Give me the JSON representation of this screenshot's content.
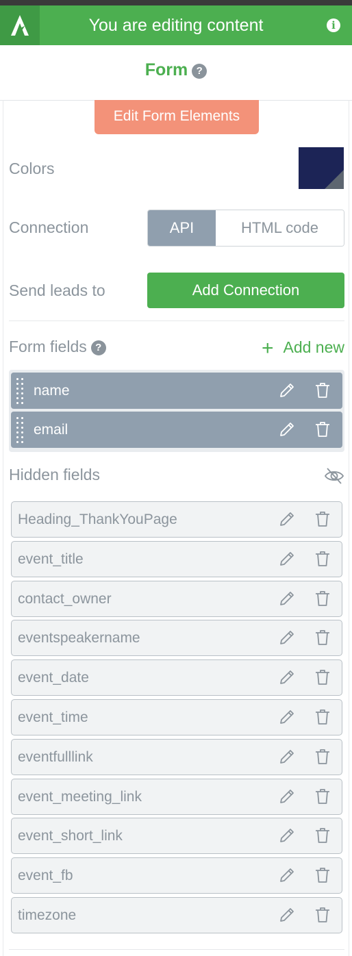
{
  "header": {
    "title": "You are editing content",
    "info_icon": "info-icon",
    "logo_icon": "logo-icon",
    "bg_color": "#4caf50"
  },
  "subheader": {
    "title": "Form",
    "help_icon": "?"
  },
  "edit_button": {
    "label": "Edit Form Elements",
    "color": "#f39279"
  },
  "colors_row": {
    "label": "Colors",
    "swatch_color": "#1c2456"
  },
  "connection_row": {
    "label": "Connection",
    "options": [
      "API",
      "HTML code"
    ],
    "selected": "API"
  },
  "send_leads_row": {
    "label": "Send leads to",
    "button_label": "Add Connection"
  },
  "form_fields": {
    "label": "Form fields",
    "help_icon": "?",
    "add_new_label": "Add new",
    "add_new_icon": "+",
    "items": [
      {
        "label": "name"
      },
      {
        "label": "email"
      }
    ]
  },
  "hidden_fields": {
    "label": "Hidden fields",
    "visibility_icon": "eye-slash-icon",
    "items": [
      {
        "label": "Heading_ThankYouPage"
      },
      {
        "label": "event_title"
      },
      {
        "label": "contact_owner"
      },
      {
        "label": "eventspeakername"
      },
      {
        "label": "event_date"
      },
      {
        "label": "event_time"
      },
      {
        "label": "eventfulllink"
      },
      {
        "label": "event_meeting_link"
      },
      {
        "label": "event_short_link"
      },
      {
        "label": "event_fb"
      },
      {
        "label": "timezone"
      }
    ]
  }
}
